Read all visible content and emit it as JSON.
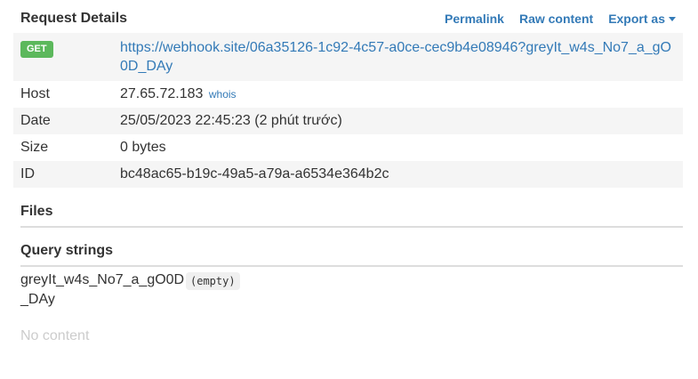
{
  "header": {
    "title": "Request Details",
    "permalink_label": "Permalink",
    "raw_content_label": "Raw content",
    "export_label": "Export as"
  },
  "request": {
    "method": "GET",
    "url": "https://webhook.site/06a35126-1c92-4c57-a0ce-cec9b4e08946?greyIt_w4s_No7_a_gO0D_DAy",
    "rows": [
      {
        "key": "Host",
        "value": "27.65.72.183",
        "link": "whois"
      },
      {
        "key": "Date",
        "value": "25/05/2023 22:45:23 (2 phút trước)"
      },
      {
        "key": "Size",
        "value": "0 bytes"
      },
      {
        "key": "ID",
        "value": "bc48ac65-b19c-49a5-a79a-a6534e364b2c"
      }
    ]
  },
  "sections": {
    "files_title": "Files",
    "query_title": "Query strings"
  },
  "query": {
    "key": "greyIt_w4s_No7_a_gO0D_DAy",
    "value": "(empty)"
  },
  "body": {
    "empty_text": "No content"
  },
  "colors": {
    "link": "#337ab7",
    "method_badge": "#5cb85c",
    "stripe": "#f5f5f5"
  }
}
